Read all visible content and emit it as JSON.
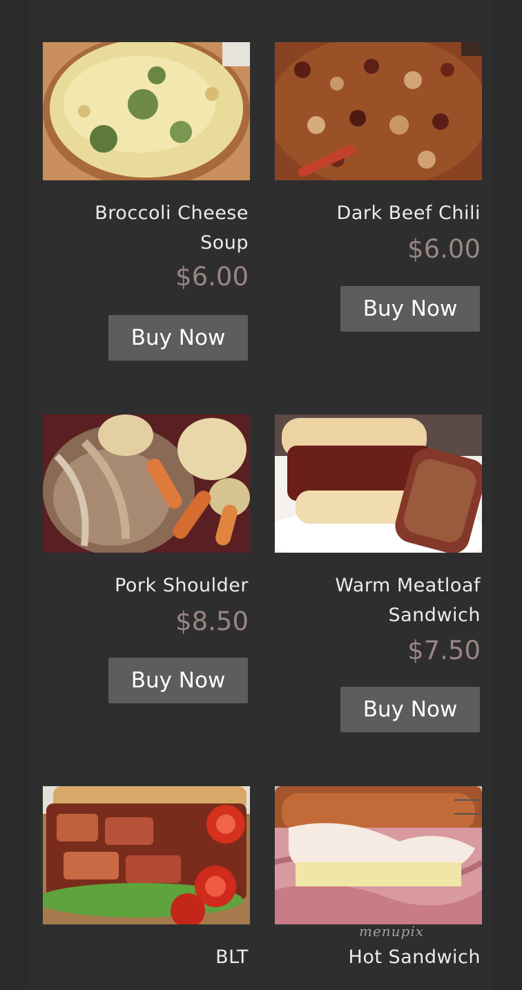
{
  "menu": {
    "items": [
      {
        "title": "Broccoli Cheese Soup",
        "price": "$6.00",
        "button": "Buy Now",
        "image": "broccoli-cheese-soup-photo"
      },
      {
        "title": "Dark Beef Chili",
        "price": "$6.00",
        "button": "Buy Now",
        "image": "beef-chili-photo"
      },
      {
        "title": "Pork Shoulder",
        "price": "$8.50",
        "button": "Buy Now",
        "image": "pork-shoulder-photo"
      },
      {
        "title": "Warm Meatloaf Sandwich",
        "price": "$7.50",
        "button": "Buy Now",
        "image": "meatloaf-sandwich-photo"
      },
      {
        "title": "BLT",
        "price": "",
        "button": "",
        "image": "blt-photo"
      },
      {
        "title": "Hot Sandwich",
        "price": "",
        "button": "",
        "image": "hot-sandwich-photo"
      }
    ]
  },
  "watermark": "menupix",
  "colors": {
    "background": "#2b2b2b",
    "text": "#ececec",
    "price": "#9a8585",
    "button": "#5d5d5d"
  }
}
